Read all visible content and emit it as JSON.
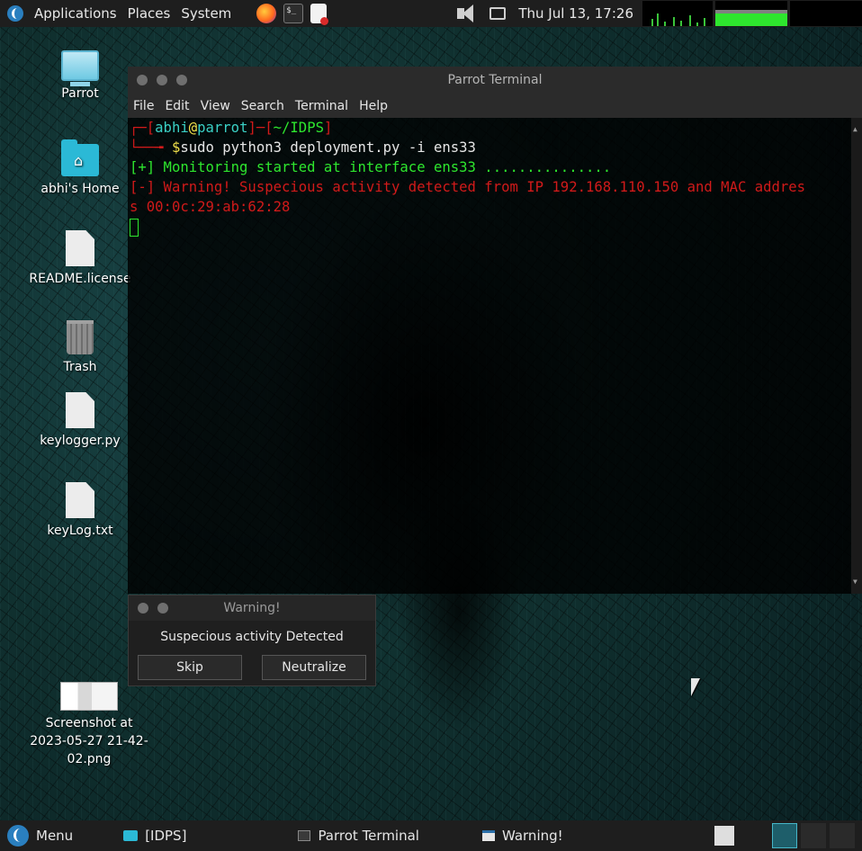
{
  "top_panel": {
    "applications": "Applications",
    "places": "Places",
    "system": "System",
    "clock": "Thu Jul 13, 17:26"
  },
  "desktop_icons": [
    {
      "label": "Parrot"
    },
    {
      "label": "abhi's Home"
    },
    {
      "label": "README.license"
    },
    {
      "label": "Trash"
    },
    {
      "label": "keylogger.py"
    },
    {
      "label": "keyLog.txt"
    },
    {
      "label": "Screenshot at 2023-05-27 21-42-02.png"
    }
  ],
  "terminal": {
    "title": "Parrot Terminal",
    "menu": [
      "File",
      "Edit",
      "View",
      "Search",
      "Terminal",
      "Help"
    ],
    "prompt_user": "abhi",
    "prompt_at": "@",
    "prompt_host": "parrot",
    "prompt_dir": "~/IDPS",
    "command": "sudo python3 deployment.py -i ens33",
    "line_ok": "[+] Monitoring started at interface ens33 ...............",
    "line_warn_1": "[-] Warning! Suspecious activity detected from IP 192.168.110.150 and MAC addres",
    "line_warn_2": "s 00:0c:29:ab:62:28"
  },
  "warning_dialog": {
    "title": "Warning!",
    "message": "Suspecious activity Detected",
    "skip": "Skip",
    "neutralize": "Neutralize"
  },
  "taskbar": {
    "menu": "Menu",
    "items": [
      "[IDPS]",
      "Parrot Terminal",
      "Warning!"
    ]
  },
  "colors": {
    "accent": "#2bb9d6",
    "terminal_green": "#2ee62e",
    "terminal_red": "#d11a1a"
  }
}
